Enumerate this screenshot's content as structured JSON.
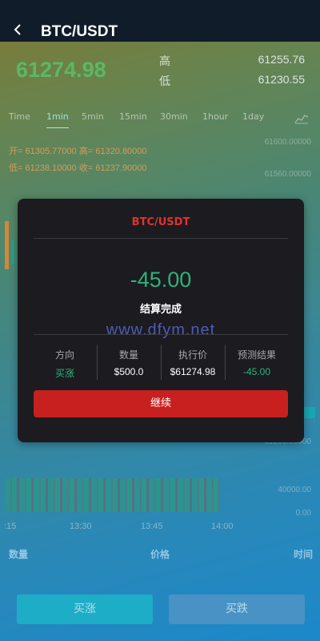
{
  "header": {
    "title": "BTC/USDT"
  },
  "ticker": {
    "price": "61274.98",
    "high_label": "高",
    "high_value": "61255.76",
    "low_label": "低",
    "low_value": "61230.55"
  },
  "tabs": [
    "Time",
    "1min",
    "5min",
    "15min",
    "30min",
    "1hour",
    "1day"
  ],
  "active_tab": "1min",
  "ohlc": {
    "open_label": "开=",
    "open_value": "61305.77000",
    "high_label": "高=",
    "high_value": "61320.80000",
    "low_label": "低=",
    "low_value": "61238.10000",
    "close_label": "收=",
    "close_value": "61237.90000"
  },
  "axis": {
    "price_ticks": [
      "61600.00000",
      "61560.00000",
      "61200.00000"
    ],
    "volume_ticks": [
      "40000.00",
      "0.00"
    ],
    "time_ticks": [
      ":15",
      "13:30",
      "13:45",
      "14:00"
    ]
  },
  "columns": {
    "qty": "数量",
    "price": "价格",
    "time": "时间"
  },
  "actions": {
    "buy_up": "买涨",
    "buy_down": "买跌"
  },
  "modal": {
    "title": "BTC/USDT",
    "amount": "-45.00",
    "status": "结算完成",
    "watermark": "www.dfym.net",
    "info": [
      {
        "label": "方向",
        "value": "买涨"
      },
      {
        "label": "数量",
        "value": "$500.0"
      },
      {
        "label": "执行价",
        "value": "$61274.98"
      },
      {
        "label": "预测结果",
        "value": "-45.00"
      }
    ],
    "continue": "继续"
  },
  "colors": {
    "price_up": "#5ec46a",
    "result_loss": "#2bb47a",
    "modal_title": "#e0332f",
    "continue_button": "#c8201e"
  }
}
